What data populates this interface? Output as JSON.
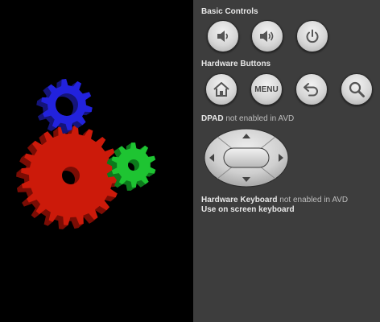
{
  "panel": {
    "basic_controls": {
      "title": "Basic Controls",
      "buttons": [
        {
          "name": "volume-down",
          "icon": "volume-down-icon"
        },
        {
          "name": "volume-up",
          "icon": "volume-up-icon"
        },
        {
          "name": "power",
          "icon": "power-icon"
        }
      ]
    },
    "hardware_buttons": {
      "title": "Hardware Buttons",
      "menu_label": "MENU",
      "buttons": [
        {
          "name": "home",
          "icon": "home-icon"
        },
        {
          "name": "menu",
          "icon": "menu-text"
        },
        {
          "name": "back",
          "icon": "back-arrow-icon"
        },
        {
          "name": "search",
          "icon": "search-icon"
        }
      ]
    },
    "dpad": {
      "title": "DPAD",
      "note": "not enabled in AVD"
    },
    "keyboard": {
      "title": "Hardware Keyboard",
      "note": "not enabled in AVD",
      "line2": "Use on screen keyboard"
    }
  },
  "colors": {
    "panel_bg": "#3d3d3d",
    "screen_bg": "#000000",
    "gear_blue": "#2222dd",
    "gear_red": "#cc1a0a",
    "gear_green": "#1ec432"
  }
}
